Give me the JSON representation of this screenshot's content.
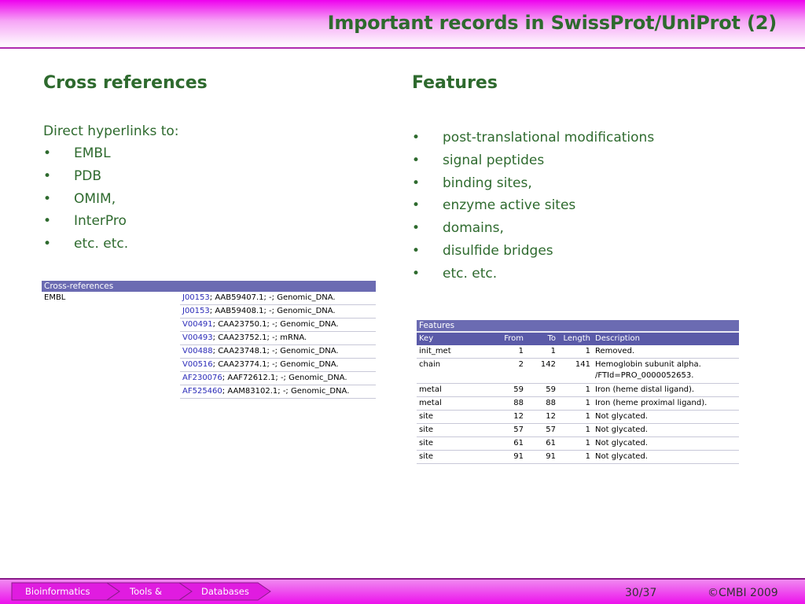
{
  "slide": {
    "title": "Important records in SwissProt/UniProt (2)",
    "left": {
      "heading": "Cross references",
      "intro": "Direct hyperlinks to:",
      "bullets": [
        "EMBL",
        "PDB",
        "OMIM,",
        "InterPro",
        "etc. etc."
      ]
    },
    "right": {
      "heading": "Features",
      "bullets": [
        "post-translational modifications",
        "signal peptides",
        "binding sites,",
        "enzyme active sites",
        "domains,",
        "disulfide bridges",
        "etc. etc."
      ]
    }
  },
  "xref_table": {
    "caption": "Cross-references",
    "db": "EMBL",
    "rows": [
      {
        "id": "J00153",
        "rest": "; AAB59407.1; -; Genomic_DNA."
      },
      {
        "id": "J00153",
        "rest": "; AAB59408.1; -; Genomic_DNA."
      },
      {
        "id": "V00491",
        "rest": "; CAA23750.1; -; Genomic_DNA."
      },
      {
        "id": "V00493",
        "rest": "; CAA23752.1; -; mRNA."
      },
      {
        "id": "V00488",
        "rest": "; CAA23748.1; -; Genomic_DNA."
      },
      {
        "id": "V00516",
        "rest": "; CAA23774.1; -; Genomic_DNA."
      },
      {
        "id": "AF230076",
        "rest": "; AAF72612.1; -; Genomic_DNA."
      },
      {
        "id": "AF525460",
        "rest": "; AAM83102.1; -; Genomic_DNA."
      }
    ]
  },
  "features_table": {
    "caption": "Features",
    "headers": [
      "Key",
      "From",
      "To",
      "Length",
      "Description"
    ],
    "rows": [
      [
        "init_met",
        "1",
        "1",
        "1",
        "Removed."
      ],
      [
        "chain",
        "2",
        "142",
        "141",
        "Hemoglobin subunit alpha."
      ],
      [
        "metal",
        "59",
        "59",
        "1",
        "Iron (heme distal ligand)."
      ],
      [
        "metal",
        "88",
        "88",
        "1",
        "Iron (heme proximal ligand)."
      ],
      [
        "site",
        "12",
        "12",
        "1",
        "Not glycated."
      ],
      [
        "site",
        "57",
        "57",
        "1",
        "Not glycated."
      ],
      [
        "site",
        "61",
        "61",
        "1",
        "Not glycated."
      ],
      [
        "site",
        "91",
        "91",
        "1",
        "Not glycated."
      ]
    ],
    "chain_ftid": "/FTId=PRO_0000052653."
  },
  "footer": {
    "breadcrumbs": [
      "Bioinformatics",
      "Tools &",
      "Databases"
    ],
    "page": "30/37",
    "copyright": "©CMBI 2009"
  },
  "colors": {
    "heading": "#2e6a2e",
    "link": "#2a2ab8",
    "table_header": "#5a5aa8",
    "accent": "#ee00ee"
  }
}
